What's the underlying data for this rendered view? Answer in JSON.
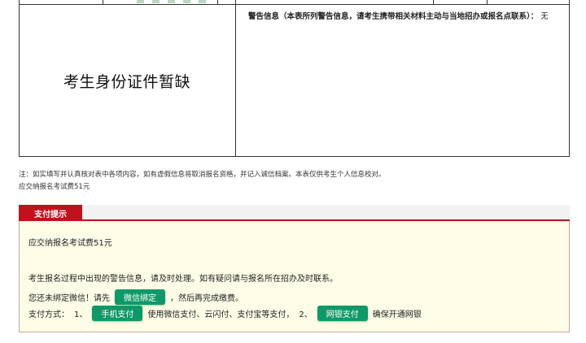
{
  "info_table": {
    "id_photo_text": "考生身份证件暂缺",
    "warning_label": "警告信息（本表所列警告信息，请考生携带相关材料主动与当地招办或报名点联系）：",
    "warning_value": "无"
  },
  "notes": {
    "line1": "注：如实填写并认真核对表中各项内容，如有虚假信息将取消报名资格，并记入诚信档案。本表仅供考生个人信息校对。",
    "line2": "应交纳报名考试费51元"
  },
  "payment": {
    "tab_label": "支付提示",
    "fee_text": "应交纳报名考试费51元",
    "warning_text": "考生报名过程中出现的警告信息，请及时处理。如有疑问请与报名所在招办及时联系。",
    "wechat_prefix": "您还未绑定微信！请先",
    "wechat_button": "微信绑定",
    "wechat_suffix": "，然后再完成缴费。",
    "methods_label": "支付方式：",
    "method1_index": "1、",
    "mobile_button": "手机支付",
    "mobile_desc": "使用微信支付、云闪付、支付宝等支付，",
    "method2_index": "2、",
    "bank_button": "网银支付",
    "bank_desc": "确保开通网银"
  },
  "colors": {
    "accent_red": "#c0121c",
    "button_green": "#0f9968",
    "panel_bg": "#fdfde7"
  }
}
